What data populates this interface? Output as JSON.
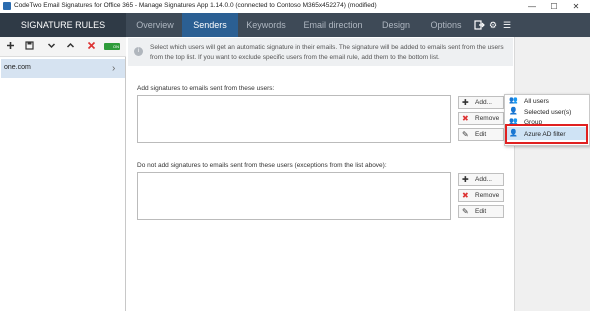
{
  "window": {
    "title": "CodeTwo Email Signatures for Office 365 - Manage Signatures App 1.14.0.0 (connected to Contoso M365x452274) (modified)",
    "minimize_glyph": "—",
    "maximize_glyph": "☐",
    "close_glyph": "✕",
    "app_icon": "app-icon"
  },
  "header": {
    "section_title": "SIGNATURE RULES",
    "tabs": [
      {
        "label": "Overview",
        "active": false
      },
      {
        "label": "Senders",
        "active": true
      },
      {
        "label": "Keywords",
        "active": false
      },
      {
        "label": "Email direction",
        "active": false
      },
      {
        "label": "Design",
        "active": false
      },
      {
        "label": "Options",
        "active": false
      }
    ],
    "icons": [
      "exit-icon",
      "gear-icon",
      "hamburger-menu-icon"
    ],
    "colors": {
      "bar": "#3e4a57",
      "active_tab": "#2b5f93",
      "left_header": "#2f3a46"
    }
  },
  "sidebar": {
    "toolbar_icons": [
      "add-icon",
      "save-icon",
      "move-down-icon",
      "move-up-icon",
      "delete-icon",
      "enable-toggle"
    ],
    "toggle_label": "ON",
    "rules": [
      {
        "label": "one.com",
        "selected": true
      }
    ]
  },
  "info": {
    "text": "Select which users will get an automatic signature in their emails. The signature will be added to emails sent from the users from the top list. If you want to exclude specific users from the email rule, add them to the bottom list."
  },
  "include_section": {
    "label": "Add signatures to emails sent from these users:",
    "buttons": {
      "add": "Add...",
      "remove": "Remove",
      "edit": "Edit"
    }
  },
  "exclude_section": {
    "label": "Do not add signatures to emails sent from these users (exceptions from the list above):",
    "buttons": {
      "add": "Add...",
      "remove": "Remove",
      "edit": "Edit"
    }
  },
  "add_menu": {
    "items": [
      {
        "label": "All users",
        "icon": "all-users-icon"
      },
      {
        "label": "Selected user(s)",
        "icon": "selected-users-icon"
      },
      {
        "label": "Group",
        "icon": "group-icon"
      },
      {
        "label": "Azure AD filter",
        "icon": "azure-ad-filter-icon",
        "highlighted": true
      }
    ],
    "highlight_color": "#e02020"
  }
}
